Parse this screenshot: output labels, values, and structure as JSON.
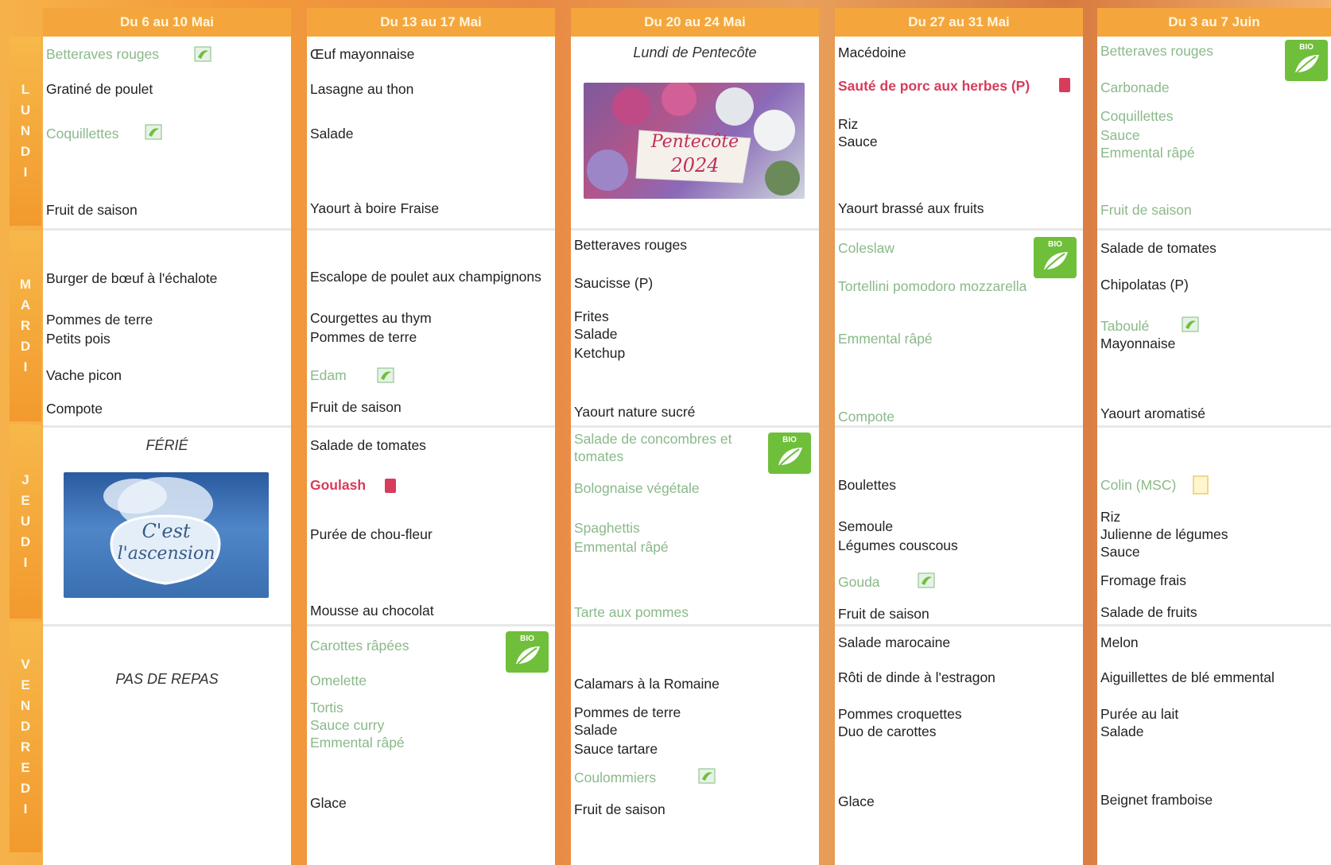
{
  "days": {
    "lundi": "LUNDI",
    "mardi": "MARDI",
    "jeudi": "JEUDI",
    "vendredi": "VENDREDI"
  },
  "weeks": [
    {
      "header": "Du 6 au 10 Mai",
      "lundi": [
        "Betteraves rouges",
        "Gratiné de poulet",
        "Coquillettes",
        "Fruit de saison"
      ],
      "mardi": [
        "Burger de bœuf à l'échalote",
        "Pommes de terre",
        "Petits pois",
        "Vache picon",
        "Compote"
      ],
      "jeudi_label": "FÉRIÉ",
      "jeudi_card": [
        "C'est",
        "l'ascension"
      ],
      "vendredi_label": "PAS DE REPAS"
    },
    {
      "header": "Du 13 au 17 Mai",
      "lundi": [
        "Œuf mayonnaise",
        "Lasagne au thon",
        "Salade",
        "Yaourt à boire Fraise"
      ],
      "mardi": [
        "Escalope de poulet aux champignons",
        "Courgettes au thym",
        "Pommes de terre",
        "Edam",
        "Fruit de saison"
      ],
      "jeudi": [
        "Salade de tomates",
        "Goulash",
        "Purée de chou-fleur",
        "Mousse au chocolat"
      ],
      "vendredi": [
        "Carottes râpées",
        "Omelette",
        "Tortis",
        "Sauce curry",
        "Emmental râpé",
        "Glace"
      ]
    },
    {
      "header": "Du 20 au 24 Mai",
      "lundi_label": "Lundi de Pentecôte",
      "lundi_card": [
        "Pentecôte",
        "2024"
      ],
      "mardi": [
        "Betteraves rouges",
        "Saucisse (P)",
        "Frites",
        "Salade",
        "Ketchup",
        "Yaourt nature sucré"
      ],
      "jeudi": [
        "Salade de concombres et",
        "tomates",
        "Bolognaise végétale",
        "Spaghettis",
        "Emmental râpé",
        "Tarte aux pommes"
      ],
      "vendredi": [
        "Calamars à la Romaine",
        "Pommes de terre",
        "Salade",
        "Sauce tartare",
        "Coulommiers",
        "Fruit de saison"
      ]
    },
    {
      "header": "Du 27 au 31 Mai",
      "lundi": [
        "Macédoine",
        "Sauté de porc aux herbes (P)",
        "Riz",
        "Sauce",
        "Yaourt brassé aux fruits"
      ],
      "mardi": [
        "Coleslaw",
        "Tortellini pomodoro mozzarella",
        "Emmental râpé",
        "Compote"
      ],
      "jeudi": [
        "Boulettes",
        "Semoule",
        "Légumes couscous",
        "Gouda",
        "Fruit de saison"
      ],
      "vendredi": [
        "Salade marocaine",
        "Rôti de dinde à l'estragon",
        "Pommes croquettes",
        "Duo de carottes",
        "Glace"
      ]
    },
    {
      "header": "Du 3 au 7 Juin",
      "lundi": [
        "Betteraves rouges",
        "Carbonade",
        "Coquillettes",
        "Sauce",
        "Emmental râpé",
        "Fruit de saison"
      ],
      "mardi": [
        "Salade de tomates",
        "Chipolatas (P)",
        "Taboulé",
        "Mayonnaise",
        "Yaourt aromatisé"
      ],
      "jeudi": [
        "Colin (MSC)",
        "Riz",
        "Julienne de légumes",
        "Sauce",
        "Fromage frais",
        "Salade de fruits"
      ],
      "vendredi": [
        "Melon",
        "Aiguillettes de blé emmental",
        "Purée au lait",
        "Salade",
        "Beignet framboise"
      ]
    }
  ],
  "badge": {
    "label": "BIO"
  },
  "colors": {
    "bio_green": "#6fbf3a",
    "bio_text": "#8ab98a",
    "pork_red": "#d73c5a",
    "header_orange": "#f4a63c"
  }
}
